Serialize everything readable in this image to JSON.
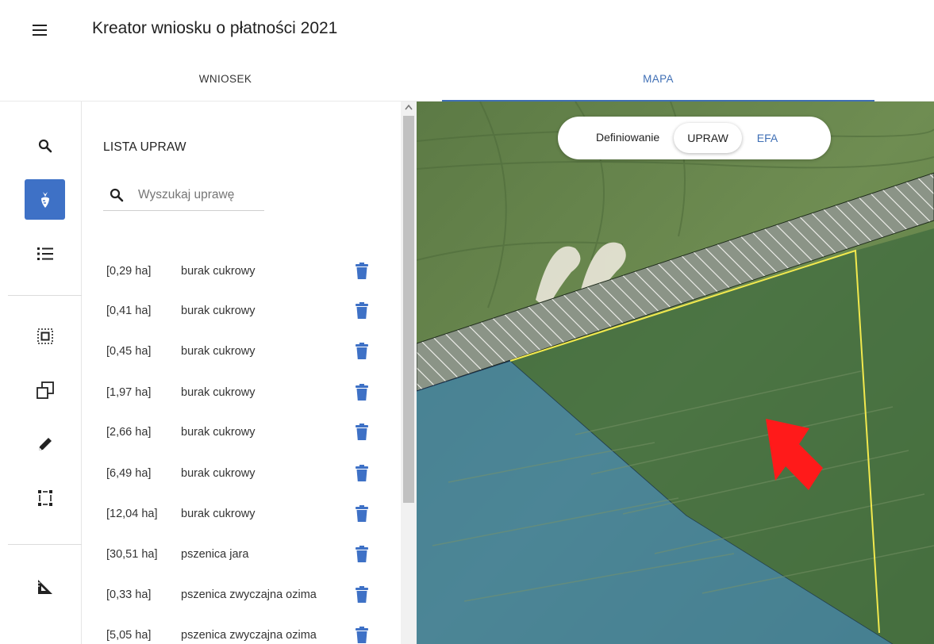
{
  "header": {
    "title": "Kreator wniosku o płatności 2021"
  },
  "tabs": [
    {
      "label": "WNIOSEK",
      "active": false
    },
    {
      "label": "MAPA",
      "active": true
    }
  ],
  "rail": {
    "icons": [
      "search-icon",
      "crop-beet-icon",
      "list-icon",
      "select-parcel-icon",
      "copy-shape-icon",
      "pencil-icon",
      "select-area-icon",
      "measure-ruler-icon"
    ],
    "active_index": 1,
    "accent": "#3e71c6"
  },
  "crop_list": {
    "title": "LISTA UPRAW",
    "search_placeholder": "Wyszukaj uprawę",
    "items": [
      {
        "area": "[0,29 ha]",
        "name": "burak cukrowy"
      },
      {
        "area": "[0,41 ha]",
        "name": "burak cukrowy"
      },
      {
        "area": "[0,45 ha]",
        "name": "burak cukrowy"
      },
      {
        "area": "[1,97 ha]",
        "name": "burak cukrowy"
      },
      {
        "area": "[2,66 ha]",
        "name": "burak cukrowy"
      },
      {
        "area": "[6,49 ha]",
        "name": "burak cukrowy"
      },
      {
        "area": "[12,04 ha]",
        "name": "burak cukrowy"
      },
      {
        "area": "[30,51 ha]",
        "name": "pszenica jara"
      },
      {
        "area": "[0,33 ha]",
        "name": "pszenica zwyczajna ozima"
      },
      {
        "area": "[5,05 ha]",
        "name": "pszenica zwyczajna ozima"
      }
    ],
    "delete_icon": "trash-icon",
    "delete_color": "#3e71c6"
  },
  "map": {
    "mode": {
      "label": "Definiowanie",
      "options": [
        "UPRAW",
        "EFA"
      ],
      "selected": "UPRAW",
      "link_color": "#3f6fb5"
    },
    "colors": {
      "selected_parcel_outline": "#f2e94e",
      "pointer_arrow": "#ff1a1a",
      "crop_overlay": "#3f82b0"
    }
  }
}
